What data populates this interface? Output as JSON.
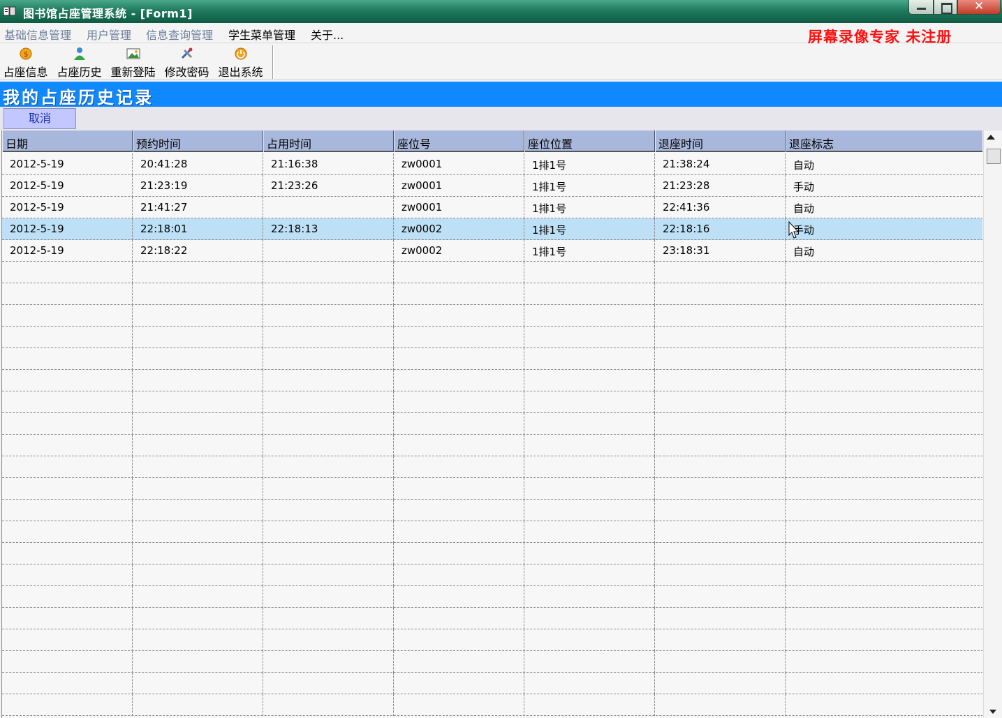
{
  "window": {
    "title": "图书馆占座管理系统 - [Form1]",
    "icon": "app-book-icon"
  },
  "menu": {
    "items": [
      {
        "label": "基础信息管理"
      },
      {
        "label": "用户管理"
      },
      {
        "label": "信息查询管理"
      },
      {
        "label": "学生菜单管理"
      },
      {
        "label": "关于..."
      }
    ],
    "watermark": "屏幕录像专家  未注册"
  },
  "toolbar": {
    "items": [
      {
        "label": "占座信息",
        "icon": "coin-icon"
      },
      {
        "label": "占座历史",
        "icon": "user-icon"
      },
      {
        "label": "重新登陆",
        "icon": "picture-icon"
      },
      {
        "label": "修改密码",
        "icon": "tools-icon"
      },
      {
        "label": "退出系统",
        "icon": "exit-icon"
      }
    ]
  },
  "page": {
    "title": "我的占座历史记录",
    "cancel_label": "取消"
  },
  "table": {
    "columns": [
      "日期",
      "预约时间",
      "占用时间",
      "座位号",
      "座位位置",
      "退座时间",
      "退座标志"
    ],
    "rows": [
      [
        "2012-5-19",
        "20:41:28",
        "21:16:38",
        "zw0001",
        "1排1号",
        "21:38:24",
        "自动"
      ],
      [
        "2012-5-19",
        "21:23:19",
        "21:23:26",
        "zw0001",
        "1排1号",
        "21:23:28",
        "手动"
      ],
      [
        "2012-5-19",
        "21:41:27",
        "",
        "zw0001",
        "1排1号",
        "22:41:36",
        "自动"
      ],
      [
        "2012-5-19",
        "22:18:01",
        "22:18:13",
        "zw0002",
        "1排1号",
        "22:18:16",
        "手动"
      ],
      [
        "2012-5-19",
        "22:18:22",
        "",
        "zw0002",
        "1排1号",
        "23:18:31",
        "自动"
      ]
    ],
    "selected_row": 3
  },
  "colors": {
    "banner": "#1088ff",
    "header": "#a8b8dc",
    "selected": "#bde0f6",
    "watermark": "#ff1010"
  }
}
